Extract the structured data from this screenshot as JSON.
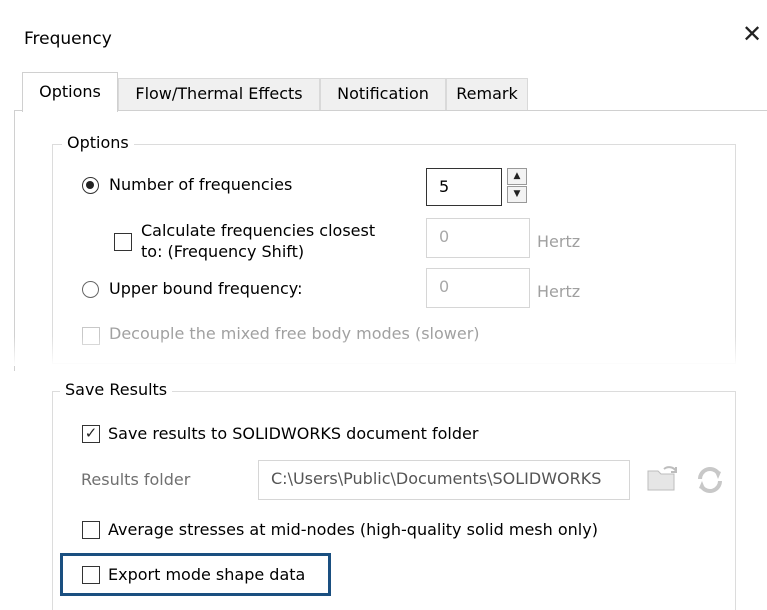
{
  "window": {
    "title": "Frequency"
  },
  "tabs": [
    {
      "label": "Options",
      "active": true
    },
    {
      "label": "Flow/Thermal Effects",
      "active": false
    },
    {
      "label": "Notification",
      "active": false
    },
    {
      "label": "Remark",
      "active": false
    }
  ],
  "options_group": {
    "legend": "Options",
    "number_of_frequencies_label": "Number of frequencies",
    "number_of_frequencies_value": "5",
    "calc_closest_label_line1": "Calculate frequencies closest",
    "calc_closest_label_line2": "to: (Frequency Shift)",
    "calc_closest_value": "0",
    "calc_closest_unit": "Hertz",
    "upper_bound_label": "Upper bound frequency:",
    "upper_bound_value": "0",
    "upper_bound_unit": "Hertz",
    "decouple_label": "Decouple the mixed free body modes (slower)"
  },
  "save_results_group": {
    "legend": "Save Results",
    "save_to_folder_label": "Save results to SOLIDWORKS document folder",
    "save_to_folder_checked": true,
    "results_folder_label": "Results folder",
    "results_folder_value": "C:\\Users\\Public\\Documents\\SOLIDWORKS",
    "average_stresses_label": "Average stresses at mid-nodes (high-quality solid mesh only)",
    "export_mode_shape_label": "Export mode shape data"
  },
  "colors": {
    "highlight": "#1a4f80",
    "disabled_text": "#a0a0a0"
  }
}
